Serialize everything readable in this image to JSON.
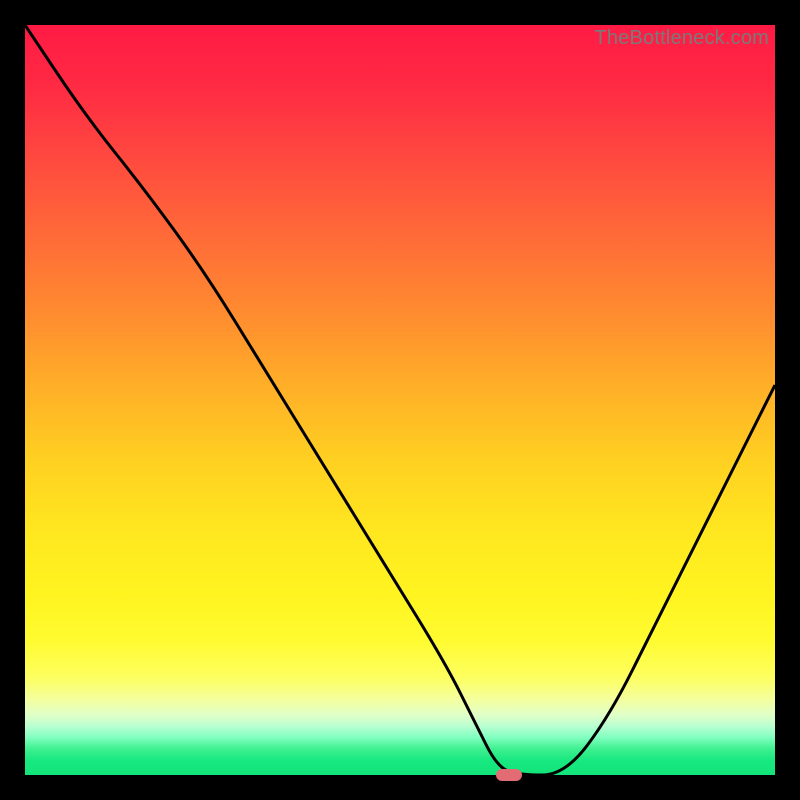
{
  "watermark": "TheBottleneck.com",
  "colors": {
    "background": "#000000",
    "curve_stroke": "#000000",
    "marker_fill": "#e36b74",
    "gradient_top": "#ff1a44",
    "gradient_bottom": "#12e47a"
  },
  "chart_data": {
    "type": "line",
    "title": "",
    "xlabel": "",
    "ylabel": "",
    "xlim": [
      0,
      100
    ],
    "ylim": [
      0,
      100
    ],
    "x": [
      0,
      8,
      16,
      24,
      32,
      40,
      48,
      56,
      60,
      63,
      66,
      72,
      78,
      84,
      90,
      96,
      100
    ],
    "values": [
      100,
      88,
      78,
      67,
      54,
      41,
      28,
      15,
      7,
      1,
      0,
      0,
      8,
      20,
      32,
      44,
      52
    ],
    "marker": {
      "x": 64.5,
      "y": 0
    },
    "annotations": []
  }
}
